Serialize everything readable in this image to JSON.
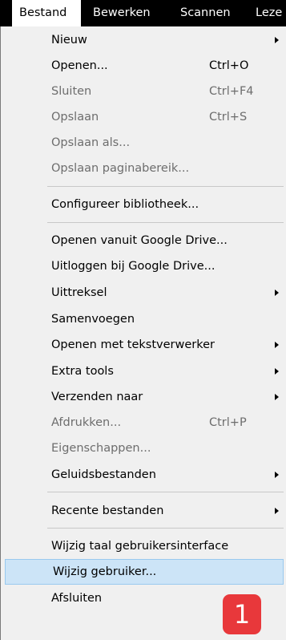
{
  "menubar": {
    "items": [
      {
        "label": "Bestand"
      },
      {
        "label": "Bewerken"
      },
      {
        "label": "Scannen"
      },
      {
        "label": "Leze"
      }
    ]
  },
  "menu": {
    "items": [
      {
        "label": "Nieuw",
        "submenu": true
      },
      {
        "label": "Openen...",
        "shortcut": "Ctrl+O"
      },
      {
        "label": "Sluiten",
        "shortcut": "Ctrl+F4",
        "disabled": true
      },
      {
        "label": "Opslaan",
        "shortcut": "Ctrl+S",
        "disabled": true
      },
      {
        "label": "Opslaan als...",
        "disabled": true
      },
      {
        "label": "Opslaan paginabereik...",
        "disabled": true
      },
      {
        "label": "Configureer bibliotheek..."
      },
      {
        "label": "Openen vanuit Google Drive..."
      },
      {
        "label": "Uitloggen bij Google Drive..."
      },
      {
        "label": "Uittreksel",
        "submenu": true
      },
      {
        "label": "Samenvoegen"
      },
      {
        "label": "Openen met tekstverwerker",
        "submenu": true
      },
      {
        "label": "Extra tools",
        "submenu": true
      },
      {
        "label": "Verzenden naar",
        "submenu": true
      },
      {
        "label": "Afdrukken...",
        "shortcut": "Ctrl+P",
        "disabled": true
      },
      {
        "label": "Eigenschappen...",
        "disabled": true
      },
      {
        "label": "Geluidsbestanden",
        "submenu": true
      },
      {
        "label": "Recente bestanden",
        "submenu": true
      },
      {
        "label": "Wijzig taal gebruikersinterface"
      },
      {
        "label": "Wijzig gebruiker...",
        "highlighted": true
      },
      {
        "label": "Afsluiten"
      }
    ]
  },
  "annotation": {
    "badge_label": "1",
    "badge_color": "#e8383b"
  },
  "colors": {
    "highlight": "#cce4f7",
    "disabled_text": "#6d6d6d"
  }
}
